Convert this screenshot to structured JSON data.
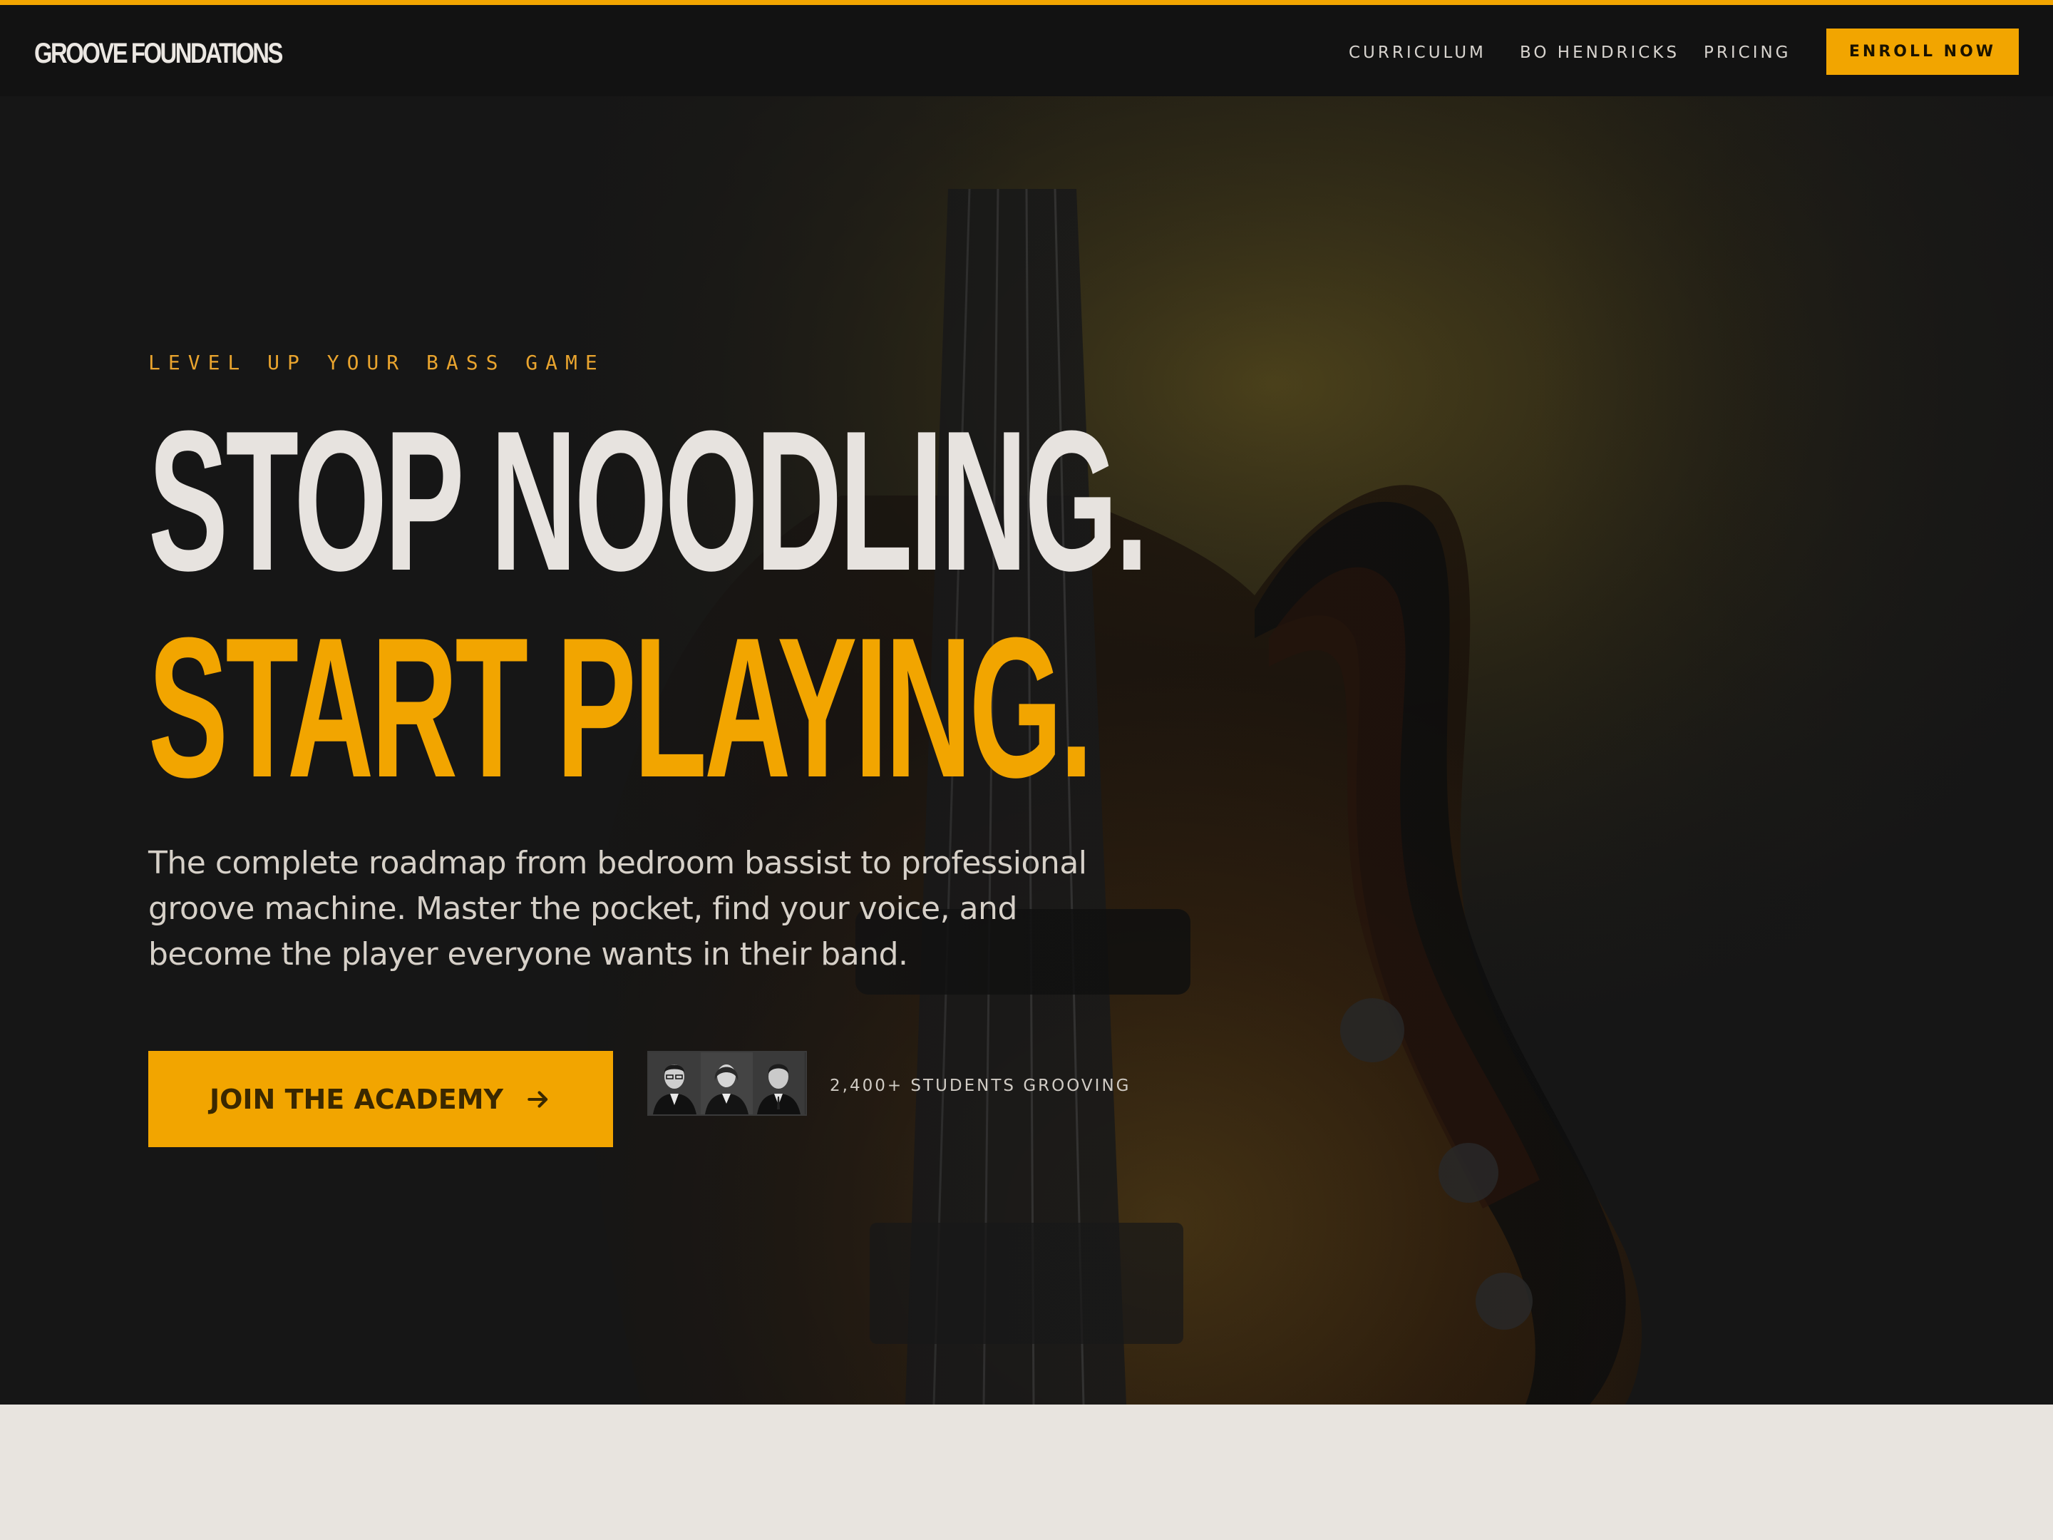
{
  "nav": {
    "logo": "GROOVE FOUNDATIONS",
    "links": [
      "CURRICULUM",
      "BO HENDRICKS",
      "PRICING"
    ],
    "cta": "ENROLL NOW"
  },
  "hero": {
    "eyebrow": "LEVEL UP YOUR BASS GAME",
    "headline_line1": "STOP NOODLING.",
    "headline_line2": "START PLAYING.",
    "subcopy": "The complete roadmap from bedroom bassist to professional groove machine. Master the pocket, find your voice, and become the player everyone wants in their band.",
    "cta_label": "JOIN THE ACADEMY",
    "cta_icon": "arrow-right-icon",
    "social_proof": "2,400+ STUDENTS GROOVING",
    "avatar_count": 3
  },
  "colors": {
    "accent": "#f2a500",
    "nav_bg": "#121212",
    "hero_bg": "#161616",
    "page_bg": "#e8e4df",
    "headline_light": "#e7e3df"
  }
}
